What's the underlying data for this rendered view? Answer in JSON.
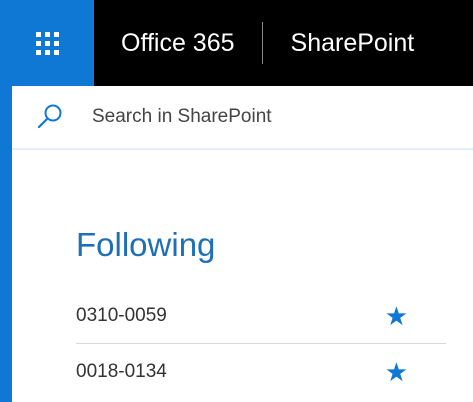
{
  "header": {
    "brand": "Office 365",
    "app": "SharePoint",
    "waffle_icon": "app-launcher-icon"
  },
  "search": {
    "placeholder": "Search in SharePoint",
    "icon": "search-icon"
  },
  "following": {
    "title": "Following",
    "items": [
      {
        "label": "0310-0059",
        "icon": "star-icon"
      },
      {
        "label": "0018-0134",
        "icon": "star-icon"
      }
    ]
  },
  "colors": {
    "accent": "#0f78d4",
    "topbar": "#000000",
    "title": "#1e6fb8"
  }
}
